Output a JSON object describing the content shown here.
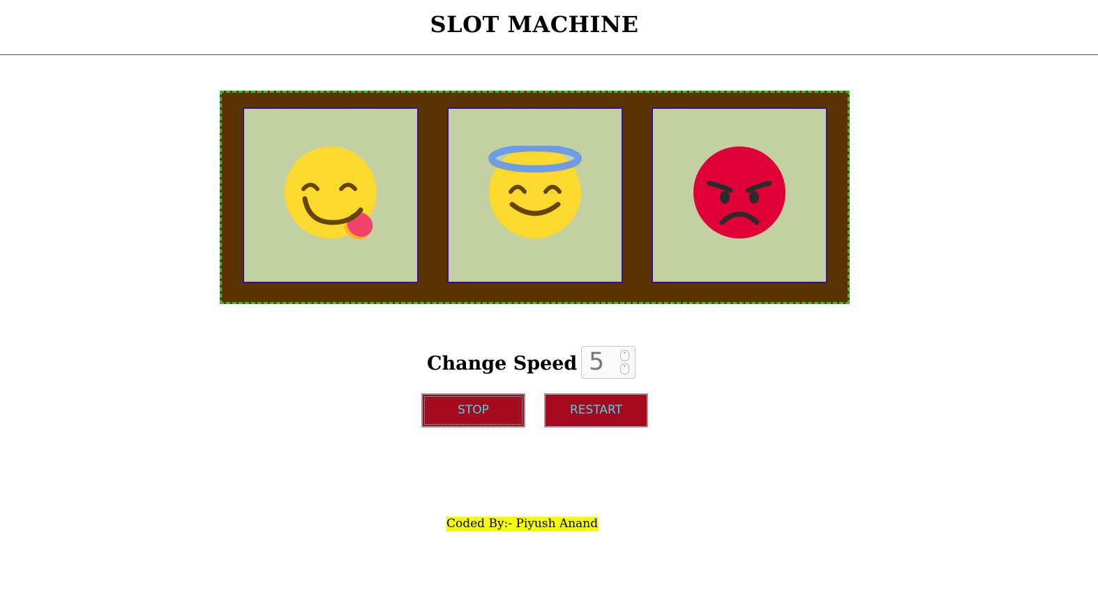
{
  "header": {
    "title": "SLOT MACHINE"
  },
  "reels": [
    {
      "icon": "face-savoring-food-icon",
      "emoji": "😋"
    },
    {
      "icon": "smiling-face-with-halo-icon",
      "emoji": "😇"
    },
    {
      "icon": "angry-face-icon",
      "emoji": "😡"
    }
  ],
  "colors": {
    "machine_bg": "#5a3400",
    "machine_border": "#2fc41a",
    "slot_bg": "#c3d0a1",
    "slot_border": "#3c0f8e",
    "button_bg": "#a30a1f",
    "button_text": "#49d6ea",
    "credit_highlight": "#f6ff00"
  },
  "controls": {
    "speed_label": "Change Speed",
    "speed_value": "5",
    "stop_label": "STOP",
    "restart_label": "RESTART"
  },
  "footer": {
    "credit": "Coded By:- Piyush Anand"
  }
}
